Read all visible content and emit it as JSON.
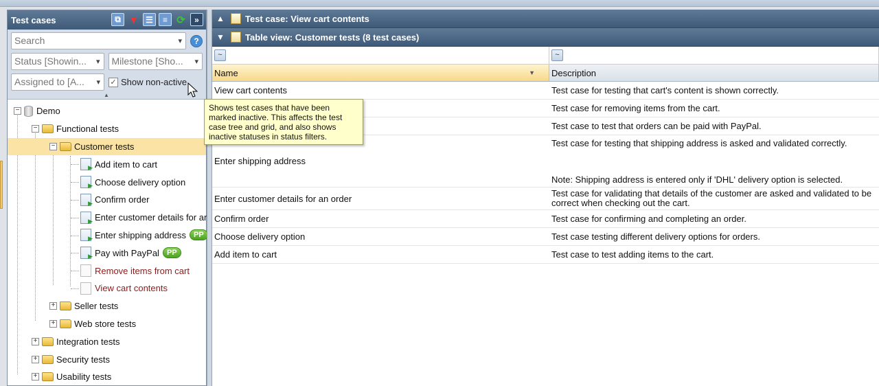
{
  "left_panel": {
    "title": "Test cases",
    "search_placeholder": "Search",
    "help_label": "?",
    "status_filter": "Status [Showin...",
    "milestone_filter": "Milestone [Sho...",
    "assigned_filter": "Assigned to [A...",
    "show_non_active_label": "Show non-active",
    "show_non_active_checked": true
  },
  "tree": {
    "root": "Demo",
    "functional": "Functional tests",
    "customer": "Customer tests",
    "items": [
      {
        "label": "Add item to cart",
        "active": true,
        "badge": ""
      },
      {
        "label": "Choose delivery option",
        "active": true,
        "badge": ""
      },
      {
        "label": "Confirm order",
        "active": true,
        "badge": ""
      },
      {
        "label": "Enter customer details for ar",
        "active": true,
        "badge": ""
      },
      {
        "label": "Enter shipping address",
        "active": true,
        "badge": "PP"
      },
      {
        "label": "Pay with PayPal",
        "active": true,
        "badge": "PP"
      },
      {
        "label": "Remove items from cart",
        "active": false,
        "badge": ""
      },
      {
        "label": "View cart contents",
        "active": false,
        "badge": ""
      }
    ],
    "seller": "Seller tests",
    "webstore": "Web store tests",
    "integration": "Integration tests",
    "security": "Security tests",
    "usability": "Usability tests"
  },
  "tooltip": "Shows test cases that have been marked inactive. This affects the test case tree and grid, and also shows inactive statuses in status filters.",
  "right_panel": {
    "bar1": "Test case: View cart contents",
    "bar2": "Table view: Customer tests (8 test cases)",
    "filter_btn": "~",
    "col_name": "Name",
    "col_desc": "Description",
    "rows": [
      {
        "name": "View cart contents",
        "desc": [
          "Test case for testing that cart's content is shown correctly."
        ]
      },
      {
        "name": "",
        "desc": [
          "Test case for removing items from the cart."
        ]
      },
      {
        "name": "",
        "desc": [
          "Test case to test that orders can be paid with PayPal."
        ]
      },
      {
        "name": "Enter shipping address",
        "desc": [
          "Test case for testing that shipping address is asked and validated correctly.",
          "",
          "Note: Shipping address is entered only if 'DHL' delivery option is selected."
        ]
      },
      {
        "name": "Enter customer details for an order",
        "desc": [
          "Test case for validating that details of the customer are asked and validated to be",
          "correct when checking out the cart."
        ]
      },
      {
        "name": "Confirm order",
        "desc": [
          "Test case for confirming and completing an order."
        ]
      },
      {
        "name": "Choose delivery option",
        "desc": [
          "Test case testing different delivery options for orders."
        ]
      },
      {
        "name": "Add item to cart",
        "desc": [
          "Test case to test adding items to the cart."
        ]
      }
    ]
  }
}
